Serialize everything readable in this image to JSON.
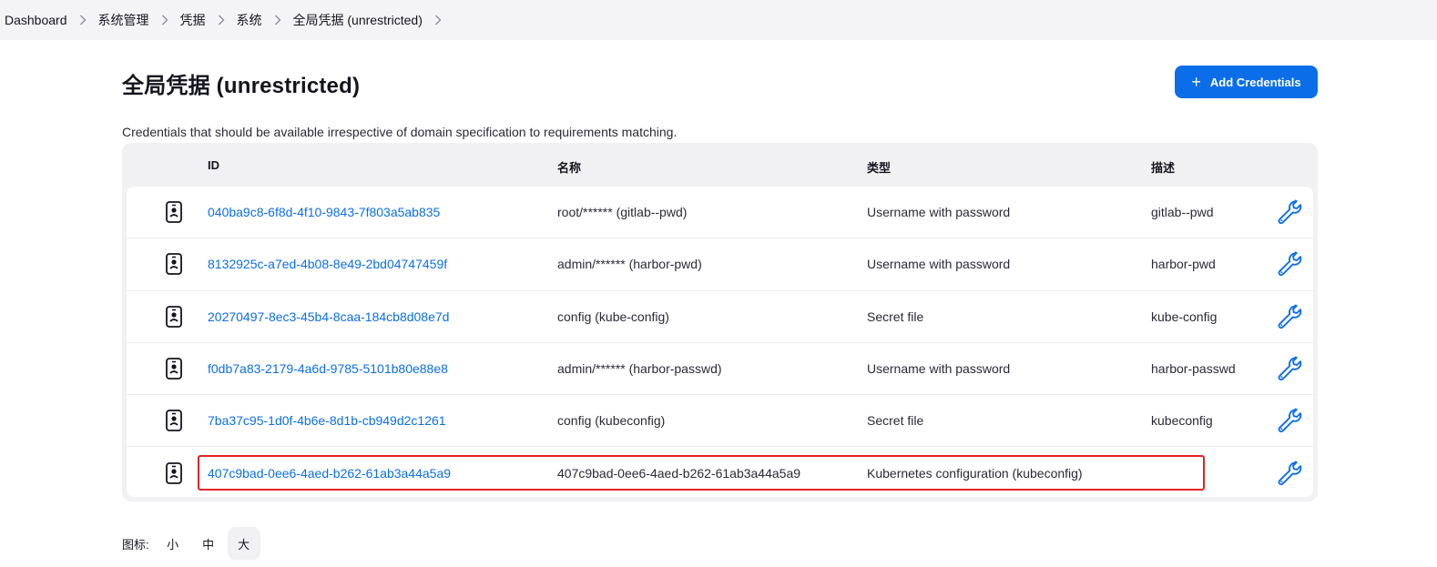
{
  "breadcrumb": [
    "Dashboard",
    "系统管理",
    "凭据",
    "系统",
    "全局凭据 (unrestricted)"
  ],
  "page": {
    "title": "全局凭据 (unrestricted)",
    "add_button_label": "Add Credentials",
    "description": "Credentials that should be available irrespective of domain specification to requirements matching."
  },
  "table": {
    "headers": {
      "id": "ID",
      "name": "名称",
      "type": "类型",
      "desc": "描述"
    },
    "rows": [
      {
        "id": "040ba9c8-6f8d-4f10-9843-7f803a5ab835",
        "name": "root/****** (gitlab--pwd)",
        "type": "Username with password",
        "desc": "gitlab--pwd"
      },
      {
        "id": "8132925c-a7ed-4b08-8e49-2bd04747459f",
        "name": "admin/****** (harbor-pwd)",
        "type": "Username with password",
        "desc": "harbor-pwd"
      },
      {
        "id": "20270497-8ec3-45b4-8caa-184cb8d08e7d",
        "name": "config (kube-config)",
        "type": "Secret file",
        "desc": "kube-config"
      },
      {
        "id": "f0db7a83-2179-4a6d-9785-5101b80e88e8",
        "name": "admin/****** (harbor-passwd)",
        "type": "Username with password",
        "desc": "harbor-passwd"
      },
      {
        "id": "7ba37c95-1d0f-4b6e-8d1b-cb949d2c1261",
        "name": "config (kubeconfig)",
        "type": "Secret file",
        "desc": "kubeconfig"
      },
      {
        "id": "407c9bad-0ee6-4aed-b262-61ab3a44a5a9",
        "name": "407c9bad-0ee6-4aed-b262-61ab3a44a5a9",
        "type": "Kubernetes configuration (kubeconfig)",
        "desc": ""
      }
    ]
  },
  "icon_size": {
    "label": "图标:",
    "options": [
      "小",
      "中",
      "大"
    ],
    "selected": "大"
  },
  "colors": {
    "accent": "#0b6ee8",
    "highlight": "#e02424"
  }
}
